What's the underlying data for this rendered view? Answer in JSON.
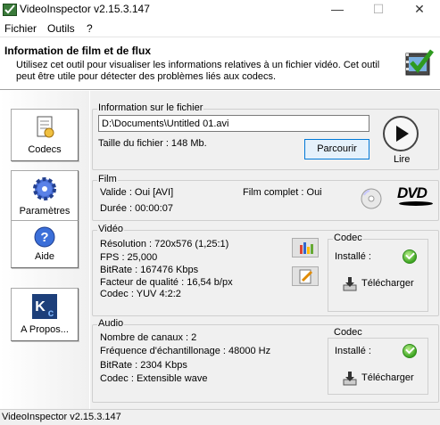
{
  "window": {
    "title": "VideoInspector v2.15.3.147",
    "minimize_glyph": "—",
    "maximize_glyph": "☐",
    "close_glyph": "✕"
  },
  "menu": {
    "items": [
      "Fichier",
      "Outils",
      "?"
    ]
  },
  "header": {
    "title": "Information de film et de flux",
    "description": "Utilisez cet outil pour visualiser les informations relatives à un fichier vidéo. Cet outil peut être utile pour détecter des problèmes liés aux codecs."
  },
  "sidebar": {
    "items": [
      {
        "label": "Codecs",
        "icon": "codecs-icon"
      },
      {
        "label": "Paramètres",
        "icon": "gear-icon"
      },
      {
        "label": "Aide",
        "icon": "help-icon"
      },
      {
        "label": "A Propos...",
        "icon": "kc-logo-icon"
      }
    ]
  },
  "file": {
    "group_title": "Information sur le fichier",
    "path": "D:\\Documents\\Untitled 01.avi",
    "size_label": "Taille du fichier : 148 Mb.",
    "browse_button": "Parcourir",
    "play_label": "Lire"
  },
  "film": {
    "group_title": "Film",
    "valid": "Valide : Oui [AVI]",
    "duration": "Durée : 00:00:07",
    "complete": "Film complet : Oui",
    "dvd_logo": "DVD"
  },
  "video": {
    "group_title": "Vidéo",
    "lines": [
      "Résolution : 720x576 (1,25:1)",
      "FPS : 25,000",
      "BitRate : 167476 Kbps",
      "Facteur de qualité : 16,54 b/px",
      "Codec : YUV 4:2:2"
    ],
    "codec": {
      "title": "Codec",
      "installed_label": "Installé :",
      "download_button": "Télécharger"
    }
  },
  "audio": {
    "group_title": "Audio",
    "lines": [
      "Nombre de canaux : 2",
      "Fréquence d'échantillonage : 48000 Hz",
      "BitRate : 2304 Kbps",
      "Codec : Extensible wave"
    ],
    "codec": {
      "title": "Codec",
      "installed_label": "Installé :",
      "download_button": "Télécharger"
    }
  },
  "status": {
    "text": "VideoInspector v2.15.3.147"
  },
  "colors": {
    "accent": "#0078d7",
    "ok_green": "#3ea523",
    "panel_bg": "#f0f0f0"
  }
}
